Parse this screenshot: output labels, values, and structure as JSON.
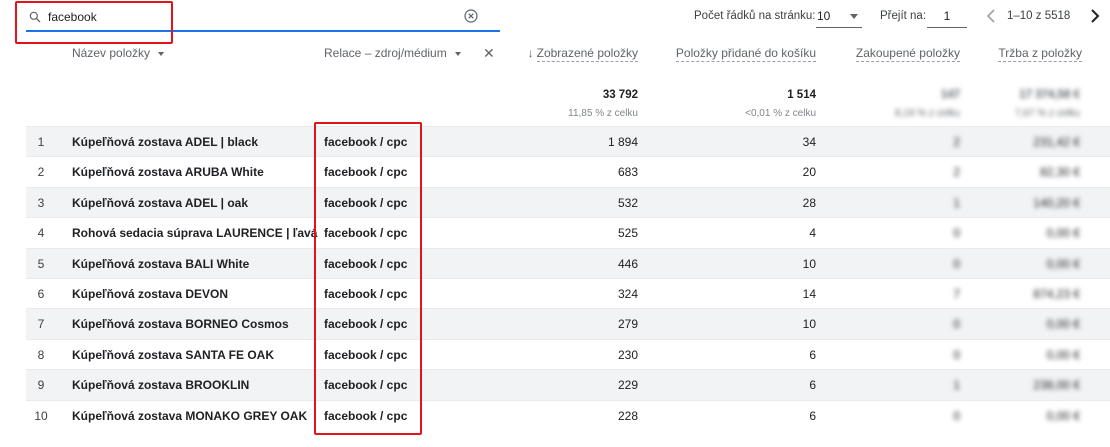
{
  "search": {
    "value": "facebook"
  },
  "pagination": {
    "rows_label": "Počet řádků na stránku:",
    "rows_value": "10",
    "goto_label": "Přejít na:",
    "goto_value": "1",
    "range": "1–10 z 5518"
  },
  "columns": {
    "name": "Název položky",
    "dimension": "Relace – zdroj/médium",
    "viewed": "Zobrazené položky",
    "added": "Položky přidané do košíku",
    "purchased": "Zakoupené položky",
    "revenue": "Tržba z položky"
  },
  "totals": {
    "viewed": "33 792",
    "viewed_sub": "11,85 % z celku",
    "added": "1 514",
    "added_sub": "<0,01 % z celku",
    "purchased": "147",
    "purchased_sub": "8,19 % z celku",
    "revenue": "17 374,58 €",
    "revenue_sub": "7,67 % z celku"
  },
  "rows": [
    {
      "idx": "1",
      "name": "Kúpeľňová zostava ADEL | black",
      "dim": "facebook / cpc",
      "viewed": "1 894",
      "added": "34",
      "purchased": "2",
      "revenue": "231,42 €"
    },
    {
      "idx": "2",
      "name": "Kúpeľňová zostava ARUBA White",
      "dim": "facebook / cpc",
      "viewed": "683",
      "added": "20",
      "purchased": "2",
      "revenue": "82,30 €"
    },
    {
      "idx": "3",
      "name": "Kúpeľňová zostava ADEL | oak",
      "dim": "facebook / cpc",
      "viewed": "532",
      "added": "28",
      "purchased": "1",
      "revenue": "140,20 €"
    },
    {
      "idx": "4",
      "name": "Rohová sedacia súprava LAURENCE | ľavá",
      "dim": "facebook / cpc",
      "viewed": "525",
      "added": "4",
      "purchased": "0",
      "revenue": "0,00 €"
    },
    {
      "idx": "5",
      "name": "Kúpeľňová zostava BALI White",
      "dim": "facebook / cpc",
      "viewed": "446",
      "added": "10",
      "purchased": "0",
      "revenue": "0,00 €"
    },
    {
      "idx": "6",
      "name": "Kúpeľňová zostava DEVON",
      "dim": "facebook / cpc",
      "viewed": "324",
      "added": "14",
      "purchased": "7",
      "revenue": "874,23 €"
    },
    {
      "idx": "7",
      "name": "Kúpeľňová zostava BORNEO Cosmos",
      "dim": "facebook / cpc",
      "viewed": "279",
      "added": "10",
      "purchased": "0",
      "revenue": "0,00 €"
    },
    {
      "idx": "8",
      "name": "Kúpeľňová zostava SANTA FE OAK",
      "dim": "facebook / cpc",
      "viewed": "230",
      "added": "6",
      "purchased": "0",
      "revenue": "0,00 €"
    },
    {
      "idx": "9",
      "name": "Kúpeľňová zostava BROOKLIN",
      "dim": "facebook / cpc",
      "viewed": "229",
      "added": "6",
      "purchased": "1",
      "revenue": "238,00 €"
    },
    {
      "idx": "10",
      "name": "Kúpeľňová zostava MONAKO GREY OAK",
      "dim": "facebook / cpc",
      "viewed": "228",
      "added": "6",
      "purchased": "0",
      "revenue": "0,00 €"
    }
  ],
  "colors": {
    "accent": "#1a73e8",
    "highlight": "#e0141b",
    "stripe": "#f1f3f4"
  }
}
